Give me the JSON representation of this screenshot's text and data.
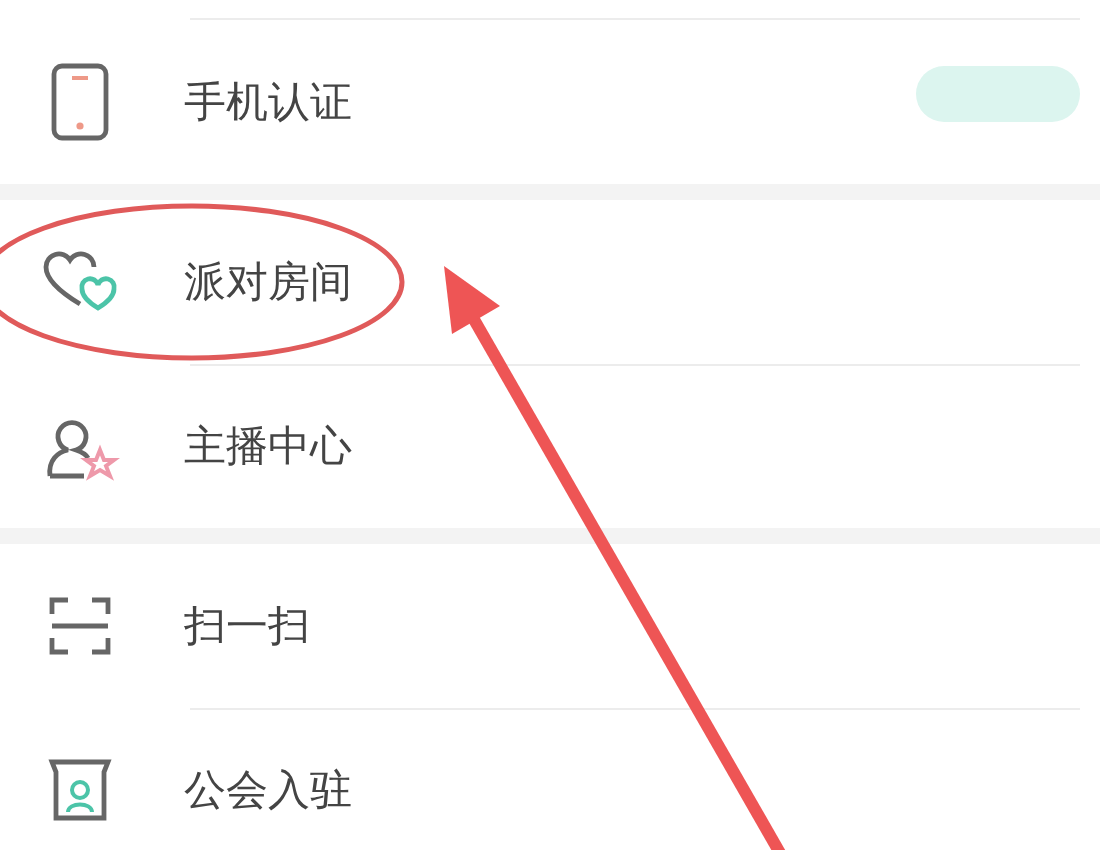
{
  "groups": [
    {
      "items": [
        {
          "label": "手机认证",
          "status_pill": true
        }
      ]
    },
    {
      "items": [
        {
          "label": "派对房间",
          "circled": true,
          "pointed_at": true
        },
        {
          "label": "主播中心"
        }
      ]
    },
    {
      "items": [
        {
          "label": "扫一扫"
        },
        {
          "label": "公会入驻"
        }
      ]
    }
  ]
}
